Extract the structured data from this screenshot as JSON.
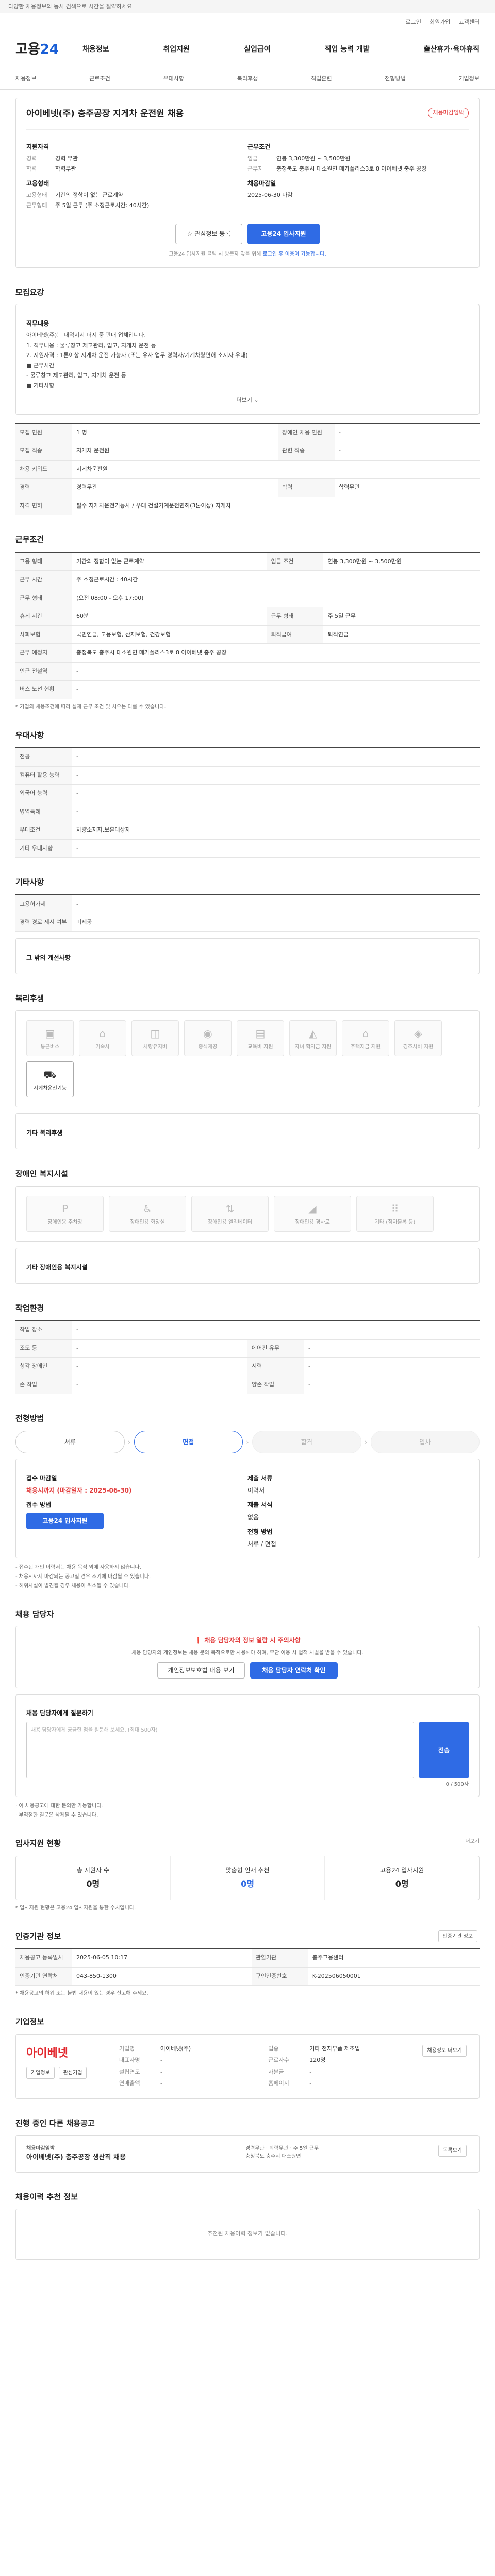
{
  "topbar": "다양한 채용정보의 동시 검색으로 시간을 절약하세요",
  "util": [
    "로그인",
    "회원가입",
    "고객센터"
  ],
  "logo": {
    "a": "고용",
    "b": "24"
  },
  "gnb": [
    "채용정보",
    "취업지원",
    "실업급여",
    "직업 능력 개발",
    "출산휴가·육아휴직"
  ],
  "subnav": [
    "채용정보",
    "근로조건",
    "우대사항",
    "복리후생",
    "직업훈련",
    "전형방법",
    "기업정보"
  ],
  "job": {
    "title": "아이베넷(주) 충주공장 지게차 운전원 채용",
    "badge": "채용마감임박",
    "summary_title_left": "지원자격",
    "summary_title_right": "근무조건",
    "left": [
      {
        "k": "경력",
        "v": "경력 무관"
      },
      {
        "k": "학력",
        "v": "학력무관"
      }
    ],
    "left2_title": "고용형태",
    "left2": [
      {
        "k": "고용형태",
        "v": "기간의 정함이 없는 근로계약"
      },
      {
        "k": "근무형태",
        "v": "주 5일 근무 (주 소정근로시간: 40시간)"
      }
    ],
    "right": [
      {
        "k": "임금",
        "v": "연봉 3,300만원 ~ 3,500만원"
      },
      {
        "k": "근무지",
        "v": "충청북도 충주시 대소원면 메가폴리스3로 8 아이베넷 충주 공장"
      }
    ],
    "right2_title": "채용마감일",
    "right2": [
      {
        "k": "",
        "v": "2025-06-30 마감"
      }
    ],
    "btn_save": "관심정보 등록",
    "btn_apply": "고용24 입사지원",
    "notice": "고용24 입사지원 클릭 시 방문자 앞을 위해 ",
    "notice_link": "로그인 후 이용이 가능합니다."
  },
  "sections": {
    "recruit": "모집요강",
    "conditions": "근무조건",
    "preference": "우대사항",
    "training": "기타사항",
    "welfare": "복리후생",
    "disability": "장애인 복지시설",
    "environment": "작업환경",
    "process": "전형방법",
    "manager": "채용 담당자",
    "history": "입사지원 현황",
    "info": "인증기관 정보",
    "company": "기업정보",
    "other": "진행 중인 다른 채용공고",
    "recommend": "채용이력 추천 정보"
  },
  "recruit": {
    "desc_title": "직무내용",
    "desc": [
      "아이베넷(주)는 대덕지시 퍼지 중 판매 업체입니다.",
      "1. 직무내용 : 물류창고 제고관리, 입고, 지게차 운전 등",
      "2. 지원자격 : 1톤이상 지게차 운전 가능자 (또는 유사 업무 경력자/기계차량면허 소지자 우대)",
      "■ 근무시간",
      " - 물류창고 제고관리, 입고, 지게차 운전 등",
      "■ 기타사항"
    ],
    "more": "더보기",
    "rows": [
      [
        {
          "k": "모집 인원",
          "v": "1 명"
        },
        {
          "k": "장애인 채용 인원",
          "v": "-"
        }
      ],
      [
        {
          "k": "모집 직종",
          "v": "지게차 운전원"
        },
        {
          "k": "관련 직종",
          "v": "-"
        }
      ],
      [
        {
          "k": "채용 키워드",
          "v": "지게차운전원"
        },
        {
          "k": "",
          "v": ""
        }
      ],
      [
        {
          "k": "경력",
          "v": "경력무관"
        },
        {
          "k": "학력",
          "v": "학력무관"
        }
      ],
      [
        {
          "k": "자격 면허",
          "v": "필수 지게차운전기능사 / 우대 건설기계운전면허(3톤이상) 지게차"
        },
        {
          "k": "",
          "v": ""
        }
      ]
    ]
  },
  "conditions": {
    "rows": [
      [
        {
          "k": "고용 형태",
          "v": "기간의 정함이 없는 근로계약"
        },
        {
          "k": "임금 조건",
          "v": "연봉 3,300만원 ~ 3,500만원"
        }
      ],
      [
        {
          "k": "근무 시간",
          "v": "주 소정근로시간 : 40시간"
        },
        {
          "k": "",
          "v": ""
        }
      ],
      [
        {
          "k": "근무 형태",
          "v": "(오전 08:00 - 오후 17:00)"
        },
        {
          "k": "",
          "v": ""
        }
      ],
      [
        {
          "k": "휴게 시간",
          "v": "60분"
        },
        {
          "k": "근무 형태",
          "v": "주 5일 근무"
        }
      ],
      [
        {
          "k": "사회보험",
          "v": "국민연금, 고용보험, 산재보험, 건강보험"
        },
        {
          "k": "퇴직급여",
          "v": "퇴직연금"
        }
      ],
      [
        {
          "k": "근무 예정지",
          "v": "충청북도 충주시 대소원면 메가폴리스3로 8 아이베넷 충주 공장"
        },
        {
          "k": "",
          "v": ""
        }
      ],
      [
        {
          "k": "인근 전철역",
          "v": "-"
        },
        {
          "k": "",
          "v": ""
        }
      ],
      [
        {
          "k": "버스 노선 현황",
          "v": "-"
        },
        {
          "k": "",
          "v": ""
        }
      ]
    ],
    "note": "* 기업의 채용조건에 따라 실제 근무 조건 및 처우는 다를 수 있습니다."
  },
  "preference": {
    "rows": [
      [
        {
          "k": "전공",
          "v": "-"
        }
      ],
      [
        {
          "k": "컴퓨터 활용 능력",
          "v": "-"
        }
      ],
      [
        {
          "k": "외국어 능력",
          "v": "-"
        }
      ],
      [
        {
          "k": "병역특례",
          "v": "-"
        }
      ],
      [
        {
          "k": "우대조건",
          "v": "차량소지자,보훈대상자"
        }
      ],
      [
        {
          "k": "기타 우대사항",
          "v": "-"
        }
      ]
    ]
  },
  "training": {
    "rows": [
      [
        {
          "k": "고용허가제",
          "v": "-"
        }
      ],
      [
        {
          "k": "경력 경로 제시 여부",
          "v": "미제공"
        }
      ]
    ],
    "sub": "그 밖의 개선사항"
  },
  "welfare": {
    "items": [
      "통근버스",
      "기숙사",
      "차량유지비",
      "중식제공",
      "교육비 지원",
      "자녀 학자금 지원",
      "주택자금 지원",
      "경조사비 지원",
      "지게차운전기능"
    ],
    "active": [
      8
    ],
    "sub": "기타 복리후생"
  },
  "disability": {
    "items": [
      "장애인용 주차장",
      "장애인용 화장실",
      "장애인용 엘리베이터",
      "장애인용 경사로",
      "기타 (점자블록 등)"
    ],
    "sub": "기타 장애인용 복지시설"
  },
  "environment": {
    "rows": [
      [
        {
          "k": "작업 장소",
          "v": "-"
        },
        {
          "k": "",
          "v": ""
        }
      ],
      [
        {
          "k": "조도 등",
          "v": "-"
        },
        {
          "k": "에어컨 유무",
          "v": "-"
        }
      ],
      [
        {
          "k": "청각 장애인",
          "v": "-"
        },
        {
          "k": "시력",
          "v": "-"
        }
      ],
      [
        {
          "k": "손 작업",
          "v": "-"
        },
        {
          "k": "양손 작업",
          "v": "-"
        }
      ]
    ]
  },
  "process": {
    "steps": [
      "서류",
      "면접",
      "합격",
      "입사"
    ],
    "apply_title": "접수 마감일",
    "apply_date": "채용시까지 (마감일자 : 2025-06-30)",
    "method_title": "접수 방법",
    "method": "고용24 입사지원",
    "doc_title": "제출 서류",
    "docs": "이력서",
    "form_title": "제출 서식",
    "form": "없음",
    "select_title": "전형 방법",
    "select": "서류 / 면접",
    "notes": [
      "- 접수된 개인 이력서는 채용 목적 외에 사용하지 않습니다.",
      "- 채용시까지 마감되는 공고일 경우 조기에 마감될 수 있습니다.",
      "- 허위사실이 발견될 경우 채용이 취소될 수 있습니다."
    ]
  },
  "manager": {
    "alert": "채용 담당자의 정보 열람 시 주의사항",
    "alert_desc": "채용 담당자의 개인정보는 채용 문의 목적으로만 사용해야 하며, 무단 이용 시 법적 처벌을 받을 수 있습니다.",
    "btn1": "개인정보보호법 내용 보기",
    "btn2": "채용 담당자 연락처 확인",
    "qa_title": "채용 담당자에게 질문하기",
    "qa_placeholder": "채용 담당자에게 궁금한 점을 질문해 보세요. (최대 500자)",
    "qa_send": "전송",
    "qa_count": "0 / 500자",
    "qa_notes": [
      "· 이 채용공고에 대한 문의만 가능합니다.",
      "· 부적절한 질문은 삭제될 수 있습니다."
    ]
  },
  "history": {
    "more": "더보기",
    "stats": [
      {
        "label": "총 지원자 수",
        "num": "0명"
      },
      {
        "label": "맞춤형 인재 추천",
        "num": "0명"
      },
      {
        "label": "고용24 입사지원",
        "num": "0명"
      }
    ],
    "note": "* 입사지원 현황은 고용24 입사지원을 통한 수치입니다."
  },
  "info": {
    "rows": [
      [
        {
          "k": "채용공고 등록일시",
          "v": "2025-06-05 10:17"
        },
        {
          "k": "관할기관",
          "v": "충주고용센터"
        }
      ],
      [
        {
          "k": "인증기관 연락처",
          "v": "043-850-1300"
        },
        {
          "k": "구인인증번호",
          "v": "K-202506050001"
        }
      ]
    ],
    "btn": "인증기관 정보",
    "note": "* 채용공고의 허위 또는 불법 내용이 있는 경우 신고해 주세요."
  },
  "company": {
    "logo": "아이베넷",
    "btn_a": "기업정보",
    "btn_b": "관심기업",
    "fields": [
      {
        "k": "기업명",
        "v": "아이베넷(주)"
      },
      {
        "k": "업종",
        "v": "기타 전자부품 제조업"
      },
      {
        "k": "대표자명",
        "v": "-"
      },
      {
        "k": "근로자수",
        "v": "120명"
      },
      {
        "k": "설립연도",
        "v": "-"
      },
      {
        "k": "자본금",
        "v": "-"
      },
      {
        "k": "연매출액",
        "v": "-"
      },
      {
        "k": "홈페이지",
        "v": "-"
      }
    ],
    "btn_c": "채용정보 더보기"
  },
  "other": {
    "badge": "채용마감임박",
    "title": "아이베넷(주) 충주공장 생산직 채용",
    "sub": [
      "경력무관",
      "학력무관",
      "주 5일 근무"
    ],
    "loc": "충청북도 충주시 대소원면",
    "btn": "목록보기"
  },
  "recommend": {
    "empty": "추천된 채용이력 정보가 없습니다."
  }
}
